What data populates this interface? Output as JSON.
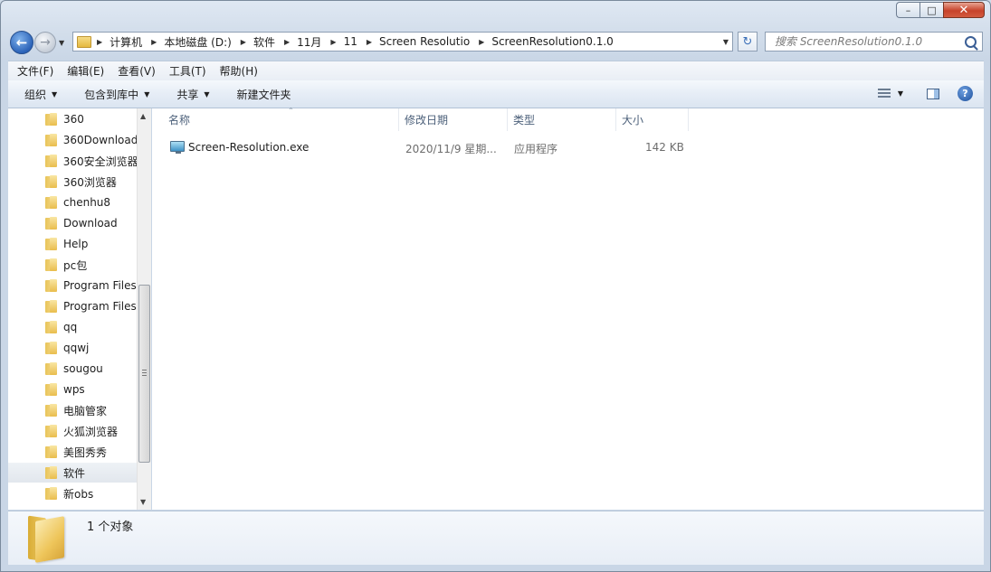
{
  "window": {
    "minimize_label": "–",
    "maximize_label": "□",
    "close_label": "✕"
  },
  "navigation": {
    "back_icon": "back-arrow-icon",
    "forward_icon": "forward-arrow-icon"
  },
  "address_bar": {
    "crumbs": [
      "计算机",
      "本地磁盘 (D:)",
      "软件",
      "11月",
      "11",
      "Screen Resolutio",
      "ScreenResolution0.1.0"
    ]
  },
  "search": {
    "placeholder": "搜索 ScreenResolution0.1.0"
  },
  "menubar": {
    "items": [
      "文件(F)",
      "编辑(E)",
      "查看(V)",
      "工具(T)",
      "帮助(H)"
    ]
  },
  "toolbar": {
    "organize": "组织",
    "include_in_library": "包含到库中",
    "share": "共享",
    "new_folder": "新建文件夹",
    "help_label": "?"
  },
  "tree": {
    "items": [
      "360",
      "360Download",
      "360安全浏览器",
      "360浏览器",
      "chenhu8",
      "Download",
      "Help",
      "pc包",
      "Program Files",
      "Program Files",
      "qq",
      "qqwj",
      "sougou",
      "wps",
      "电脑管家",
      "火狐浏览器",
      "美图秀秀",
      "软件",
      "新obs"
    ],
    "selected": "软件"
  },
  "columns": {
    "name": "名称",
    "date": "修改日期",
    "type": "类型",
    "size": "大小"
  },
  "files": [
    {
      "name": "Screen-Resolution.exe",
      "date": "2020/11/9 星期...",
      "type": "应用程序",
      "size": "142 KB"
    }
  ],
  "details": {
    "count_text": "1 个对象"
  }
}
